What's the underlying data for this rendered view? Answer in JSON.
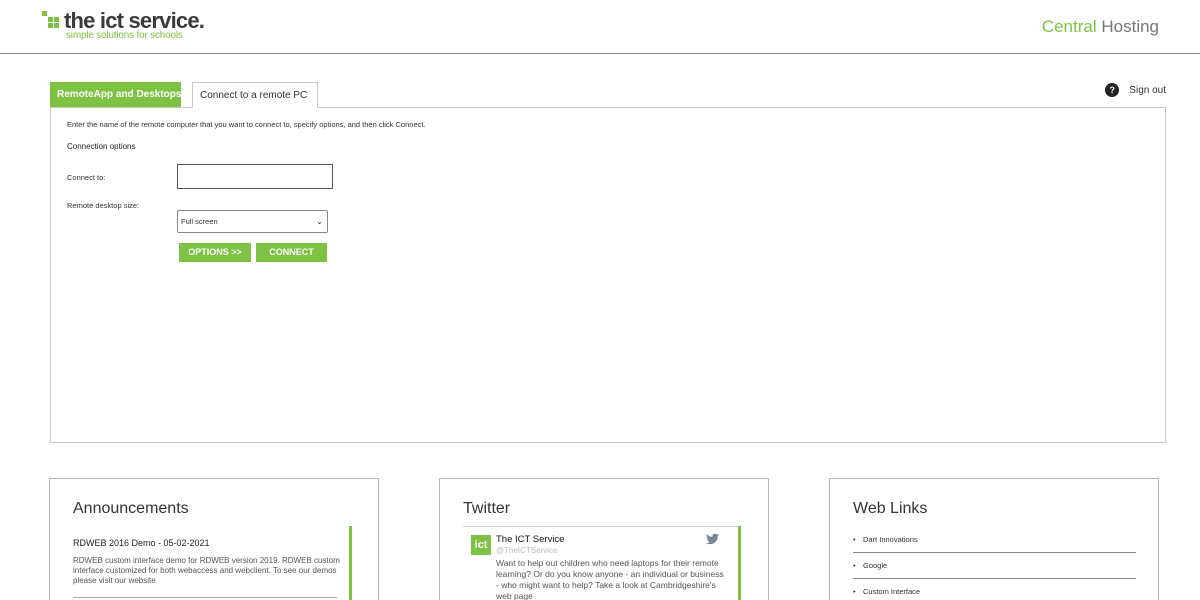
{
  "header": {
    "logo_main": "the ict service.",
    "logo_sub": "simple solutions for schools",
    "brand_part1": "Central",
    "brand_part2": "Hosting",
    "accent_color": "#7dc242"
  },
  "tabs": [
    {
      "label": "RemoteApp and Desktops",
      "active": false
    },
    {
      "label": "Connect to a remote PC",
      "active": true
    }
  ],
  "signout": {
    "icon": "help-icon",
    "help_glyph": "?",
    "label": "Sign out"
  },
  "form": {
    "instructions": "Enter the name of the remote computer that you want to connect to, specify options, and then click Connect.",
    "section_title": "Connection options",
    "connect_label": "Connect to:",
    "connect_value": "",
    "size_label": "Remote desktop size:",
    "size_selected": "Full screen",
    "options_button": "OPTIONS >>",
    "connect_button": "CONNECT"
  },
  "announcements": {
    "title": "Announcements",
    "item_heading": "RDWEB 2016 Demo - 05-02-2021",
    "item_body": "RDWEB custom interface demo for RDWEB version 2019. RDWEB custom interface customized for both webaccess and webclient. To see our demos please visit our website"
  },
  "twitter": {
    "title": "Twitter",
    "avatar_text": "ict",
    "name": "The ICT Service",
    "handle": "@TheICTService",
    "text": "Want to help out children who need laptops for their remote learning? Or do you know anyone - an individual or business - who might want to help? Take a look at Cambridgeshire's web page",
    "bird_icon": "twitter-bird-icon"
  },
  "weblinks": {
    "title": "Web Links",
    "bullet": "•",
    "items": [
      "Dart Innovations",
      "Google",
      "Custom Interface"
    ]
  }
}
